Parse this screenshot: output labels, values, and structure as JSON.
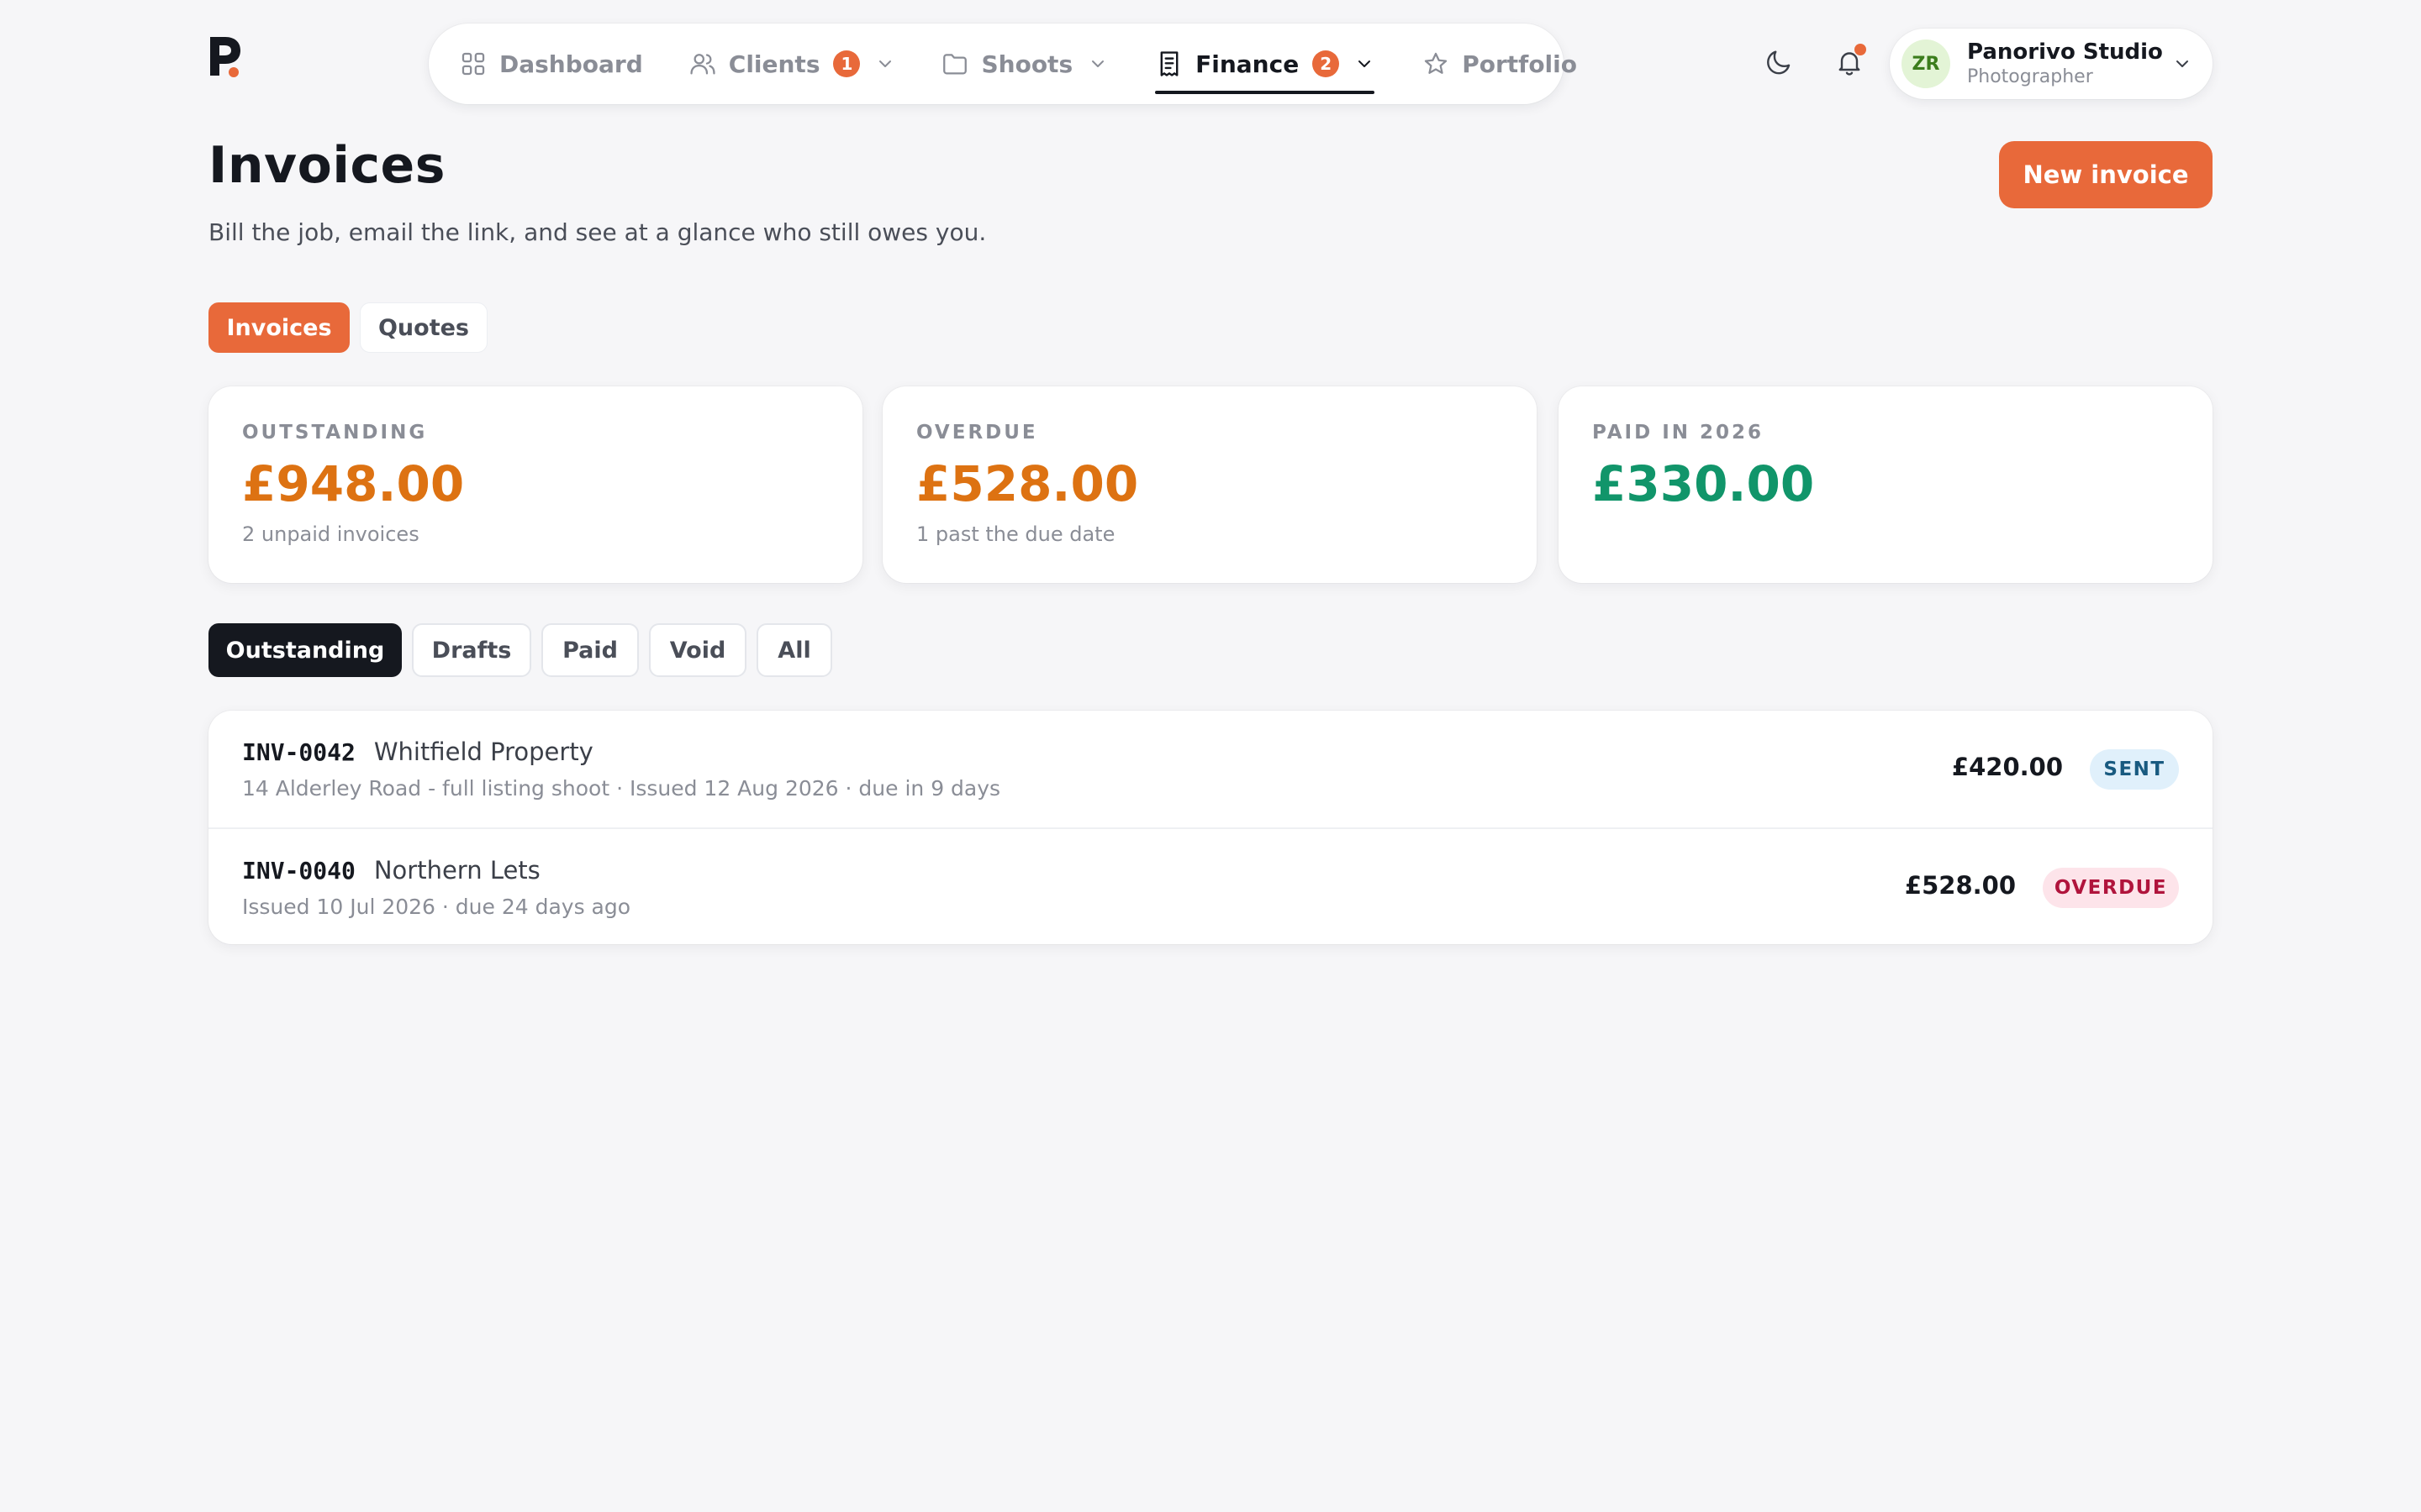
{
  "brand": {
    "logo_letter": "P",
    "accent_color": "#e8693a",
    "dark_color": "#15181f"
  },
  "nav": {
    "items": [
      {
        "label": "Dashboard",
        "icon": "grid-icon"
      },
      {
        "label": "Clients",
        "icon": "users-icon",
        "badge": "1",
        "has_dropdown": true
      },
      {
        "label": "Shoots",
        "icon": "folder-icon",
        "has_dropdown": true
      },
      {
        "label": "Finance",
        "icon": "receipt-icon",
        "badge": "2",
        "has_dropdown": true,
        "active": true
      },
      {
        "label": "Portfolio",
        "icon": "star-icon"
      }
    ]
  },
  "topbar": {
    "theme_icon": "moon-icon",
    "notifications_icon": "bell-icon",
    "user": {
      "initials": "ZR",
      "name": "Panorivo Studio",
      "role": "Photographer"
    }
  },
  "header": {
    "title": "Invoices",
    "subtitle": "Bill the job, email the link, and see at a glance who still owes you.",
    "primary_action": "New invoice"
  },
  "section_tabs": {
    "items": [
      "Invoices",
      "Quotes"
    ],
    "selected": "Invoices"
  },
  "stats": [
    {
      "label": "OUTSTANDING",
      "value": "£948.00",
      "sub": "2 unpaid invoices",
      "color": "#dd7212"
    },
    {
      "label": "OVERDUE",
      "value": "£528.00",
      "sub": "1 past the due date",
      "color": "#dd7212"
    },
    {
      "label": "PAID IN 2026",
      "value": "£330.00",
      "sub": "",
      "color": "#11956a"
    }
  ],
  "filters": {
    "items": [
      "Outstanding",
      "Drafts",
      "Paid",
      "Void",
      "All"
    ],
    "selected": "Outstanding"
  },
  "invoices": [
    {
      "number": "INV-0042",
      "client": "Whitfield Property",
      "meta": "14 Alderley Road - full listing shoot · Issued 12 Aug 2026 · due in 9 days",
      "amount": "£420.00",
      "status": "SENT"
    },
    {
      "number": "INV-0040",
      "client": "Northern Lets",
      "meta": "Issued 10 Jul 2026 · due 24 days ago",
      "amount": "£528.00",
      "status": "OVERDUE"
    }
  ]
}
